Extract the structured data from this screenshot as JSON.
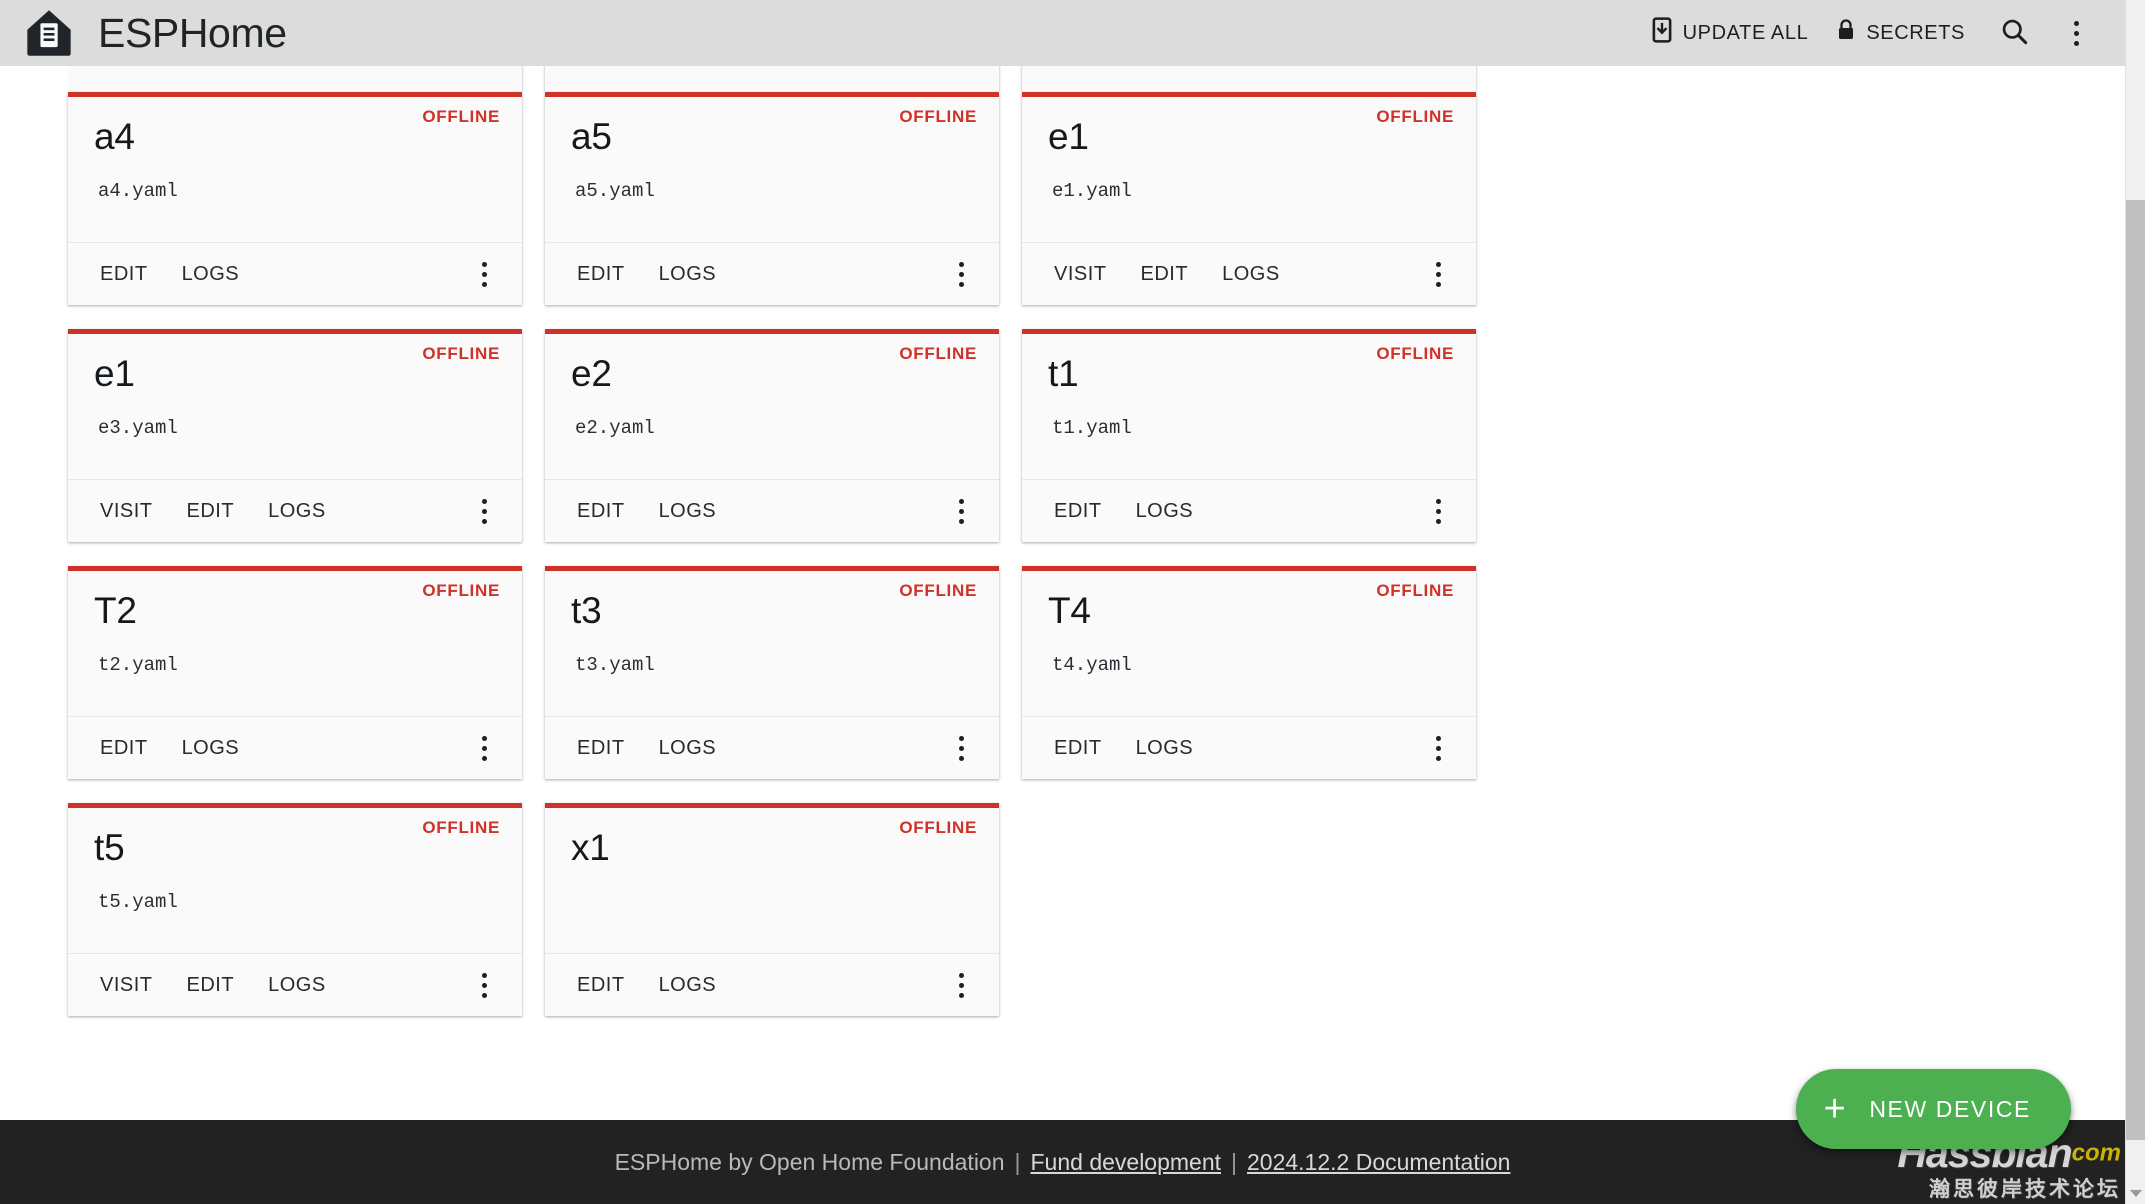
{
  "header": {
    "brand_title": "ESPHome",
    "logo_icon": "esphome-home-logo",
    "update_all_label": "UPDATE ALL",
    "update_all_icon": "update-device-icon",
    "secrets_label": "SECRETS",
    "secrets_icon": "lock-icon",
    "search_icon": "search-icon",
    "overflow_icon": "three-dots-vertical-icon"
  },
  "card_actions": {
    "visit": "VISIT",
    "edit": "EDIT",
    "logs": "LOGS",
    "more_icon": "three-dots-vertical-icon"
  },
  "status": {
    "offline": "OFFLINE"
  },
  "colors": {
    "offline_red": "#cf3228",
    "fab_green": "#4caf50",
    "header_bg": "#dcdcdc",
    "footer_bg": "#222222",
    "card_bg": "#fafafa"
  },
  "devices_clipped": [
    {
      "name": "",
      "file": "",
      "status": "",
      "actions": []
    },
    {
      "name": "",
      "file": "",
      "status": "",
      "actions": []
    },
    {
      "name": "",
      "file": "",
      "status": "",
      "actions": []
    }
  ],
  "devices": [
    {
      "name": "a4",
      "file": "a4.yaml",
      "status": "OFFLINE",
      "actions": [
        "EDIT",
        "LOGS"
      ]
    },
    {
      "name": "a5",
      "file": "a5.yaml",
      "status": "OFFLINE",
      "actions": [
        "EDIT",
        "LOGS"
      ]
    },
    {
      "name": "e1",
      "file": "e1.yaml",
      "status": "OFFLINE",
      "actions": [
        "VISIT",
        "EDIT",
        "LOGS"
      ]
    },
    {
      "name": "e1",
      "file": "e3.yaml",
      "status": "OFFLINE",
      "actions": [
        "VISIT",
        "EDIT",
        "LOGS"
      ]
    },
    {
      "name": "e2",
      "file": "e2.yaml",
      "status": "OFFLINE",
      "actions": [
        "EDIT",
        "LOGS"
      ]
    },
    {
      "name": "t1",
      "file": "t1.yaml",
      "status": "OFFLINE",
      "actions": [
        "EDIT",
        "LOGS"
      ]
    },
    {
      "name": "T2",
      "file": "t2.yaml",
      "status": "OFFLINE",
      "actions": [
        "EDIT",
        "LOGS"
      ]
    },
    {
      "name": "t3",
      "file": "t3.yaml",
      "status": "OFFLINE",
      "actions": [
        "EDIT",
        "LOGS"
      ]
    },
    {
      "name": "T4",
      "file": "t4.yaml",
      "status": "OFFLINE",
      "actions": [
        "EDIT",
        "LOGS"
      ]
    },
    {
      "name": "t5",
      "file": "t5.yaml",
      "status": "OFFLINE",
      "actions": [
        "VISIT",
        "EDIT",
        "LOGS"
      ]
    },
    {
      "name": "x1",
      "file": "",
      "status": "OFFLINE",
      "actions": [
        "EDIT",
        "LOGS"
      ]
    }
  ],
  "fab": {
    "label": "NEW DEVICE",
    "icon": "plus-icon"
  },
  "footer": {
    "text": "ESPHome by Open Home Foundation",
    "separator": "|",
    "link_fund": "Fund development",
    "link_docs": "2024.12.2 Documentation"
  },
  "watermark": {
    "name": "Hassbian",
    "tld": "com",
    "subtitle": "瀚思彼岸技术论坛"
  }
}
